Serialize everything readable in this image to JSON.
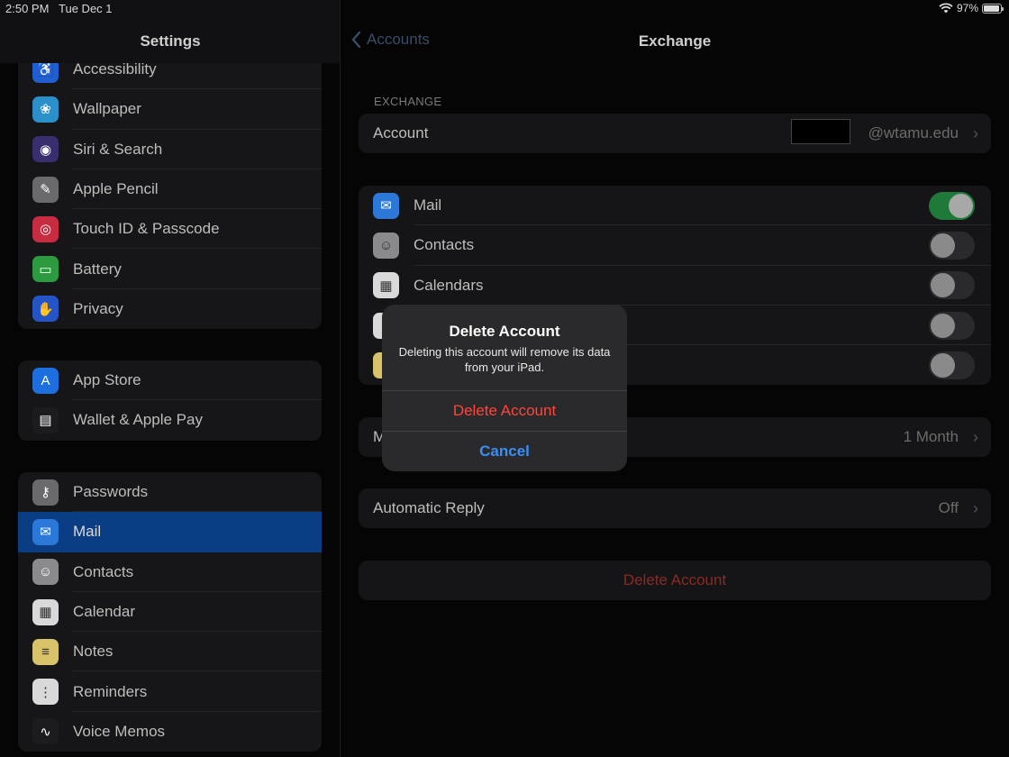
{
  "status_bar": {
    "time": "2:50 PM",
    "date": "Tue Dec 1",
    "battery": "97%",
    "battery_fill": 0.97
  },
  "sidebar": {
    "title": "Settings",
    "group1": [
      {
        "label": "Accessibility",
        "icon": "accessibility-icon",
        "color": "#1f5fd1",
        "glyph": "♿"
      },
      {
        "label": "Wallpaper",
        "icon": "wallpaper-icon",
        "color": "#2b8fc9",
        "glyph": "❀"
      },
      {
        "label": "Siri & Search",
        "icon": "siri-icon",
        "color": "#3a2f6e",
        "glyph": "◉"
      },
      {
        "label": "Apple Pencil",
        "icon": "pencil-icon",
        "color": "#6a6a6c",
        "glyph": "✎"
      },
      {
        "label": "Touch ID & Passcode",
        "icon": "fingerprint-icon",
        "color": "#c72c41",
        "glyph": "◎"
      },
      {
        "label": "Battery",
        "icon": "battery-icon",
        "color": "#2c9b3f",
        "glyph": "▭"
      },
      {
        "label": "Privacy",
        "icon": "hand-icon",
        "color": "#2554c7",
        "glyph": "✋"
      }
    ],
    "group2": [
      {
        "label": "App Store",
        "icon": "app-store-icon",
        "color": "#1d6fe0",
        "glyph": "A"
      },
      {
        "label": "Wallet & Apple Pay",
        "icon": "wallet-icon",
        "color": "#1c1c1e",
        "glyph": "▤"
      }
    ],
    "group3": [
      {
        "label": "Passwords",
        "icon": "key-icon",
        "color": "#6a6a6c",
        "glyph": "⚷"
      },
      {
        "label": "Mail",
        "icon": "mail-icon",
        "color": "#2b78d8",
        "glyph": "✉",
        "selected": true
      },
      {
        "label": "Contacts",
        "icon": "contacts-icon",
        "color": "#8a8a8c",
        "glyph": "☺"
      },
      {
        "label": "Calendar",
        "icon": "calendar-icon",
        "color": "#d9d9d9",
        "glyph": "▦"
      },
      {
        "label": "Notes",
        "icon": "notes-icon",
        "color": "#d9c36a",
        "glyph": "≡"
      },
      {
        "label": "Reminders",
        "icon": "reminders-icon",
        "color": "#d9d9d9",
        "glyph": "⋮"
      },
      {
        "label": "Voice Memos",
        "icon": "voice-memos-icon",
        "color": "#1c1c1e",
        "glyph": "∿"
      }
    ]
  },
  "detail": {
    "back_label": "Accounts",
    "title": "Exchange",
    "section_header": "EXCHANGE",
    "account": {
      "label": "Account",
      "value": "@wtamu.edu"
    },
    "services": [
      {
        "label": "Mail",
        "icon": "mail-icon",
        "color": "#2b78d8",
        "glyph": "✉",
        "on": true
      },
      {
        "label": "Contacts",
        "icon": "contacts-icon",
        "color": "#8a8a8c",
        "glyph": "☺",
        "on": false
      },
      {
        "label": "Calendars",
        "icon": "calendar-icon",
        "color": "#d9d9d9",
        "glyph": "▦",
        "on": false
      },
      {
        "label": "",
        "icon": "reminders-icon",
        "color": "#d9d9d9",
        "glyph": "⋮",
        "on": false
      },
      {
        "label": "",
        "icon": "notes-icon",
        "color": "#d9c36a",
        "glyph": "≡",
        "on": false
      }
    ],
    "mail_days": {
      "label": "M",
      "value": "1 Month"
    },
    "auto_reply": {
      "label": "Automatic Reply",
      "value": "Off"
    },
    "delete_label": "Delete Account"
  },
  "alert": {
    "title": "Delete Account",
    "message": "Deleting this account will remove its data from your iPad.",
    "destructive_label": "Delete Account",
    "cancel_label": "Cancel"
  },
  "colors": {
    "accent": "#3a8ef6",
    "destructive": "#ff453a",
    "toggle_on": "#34c759"
  }
}
